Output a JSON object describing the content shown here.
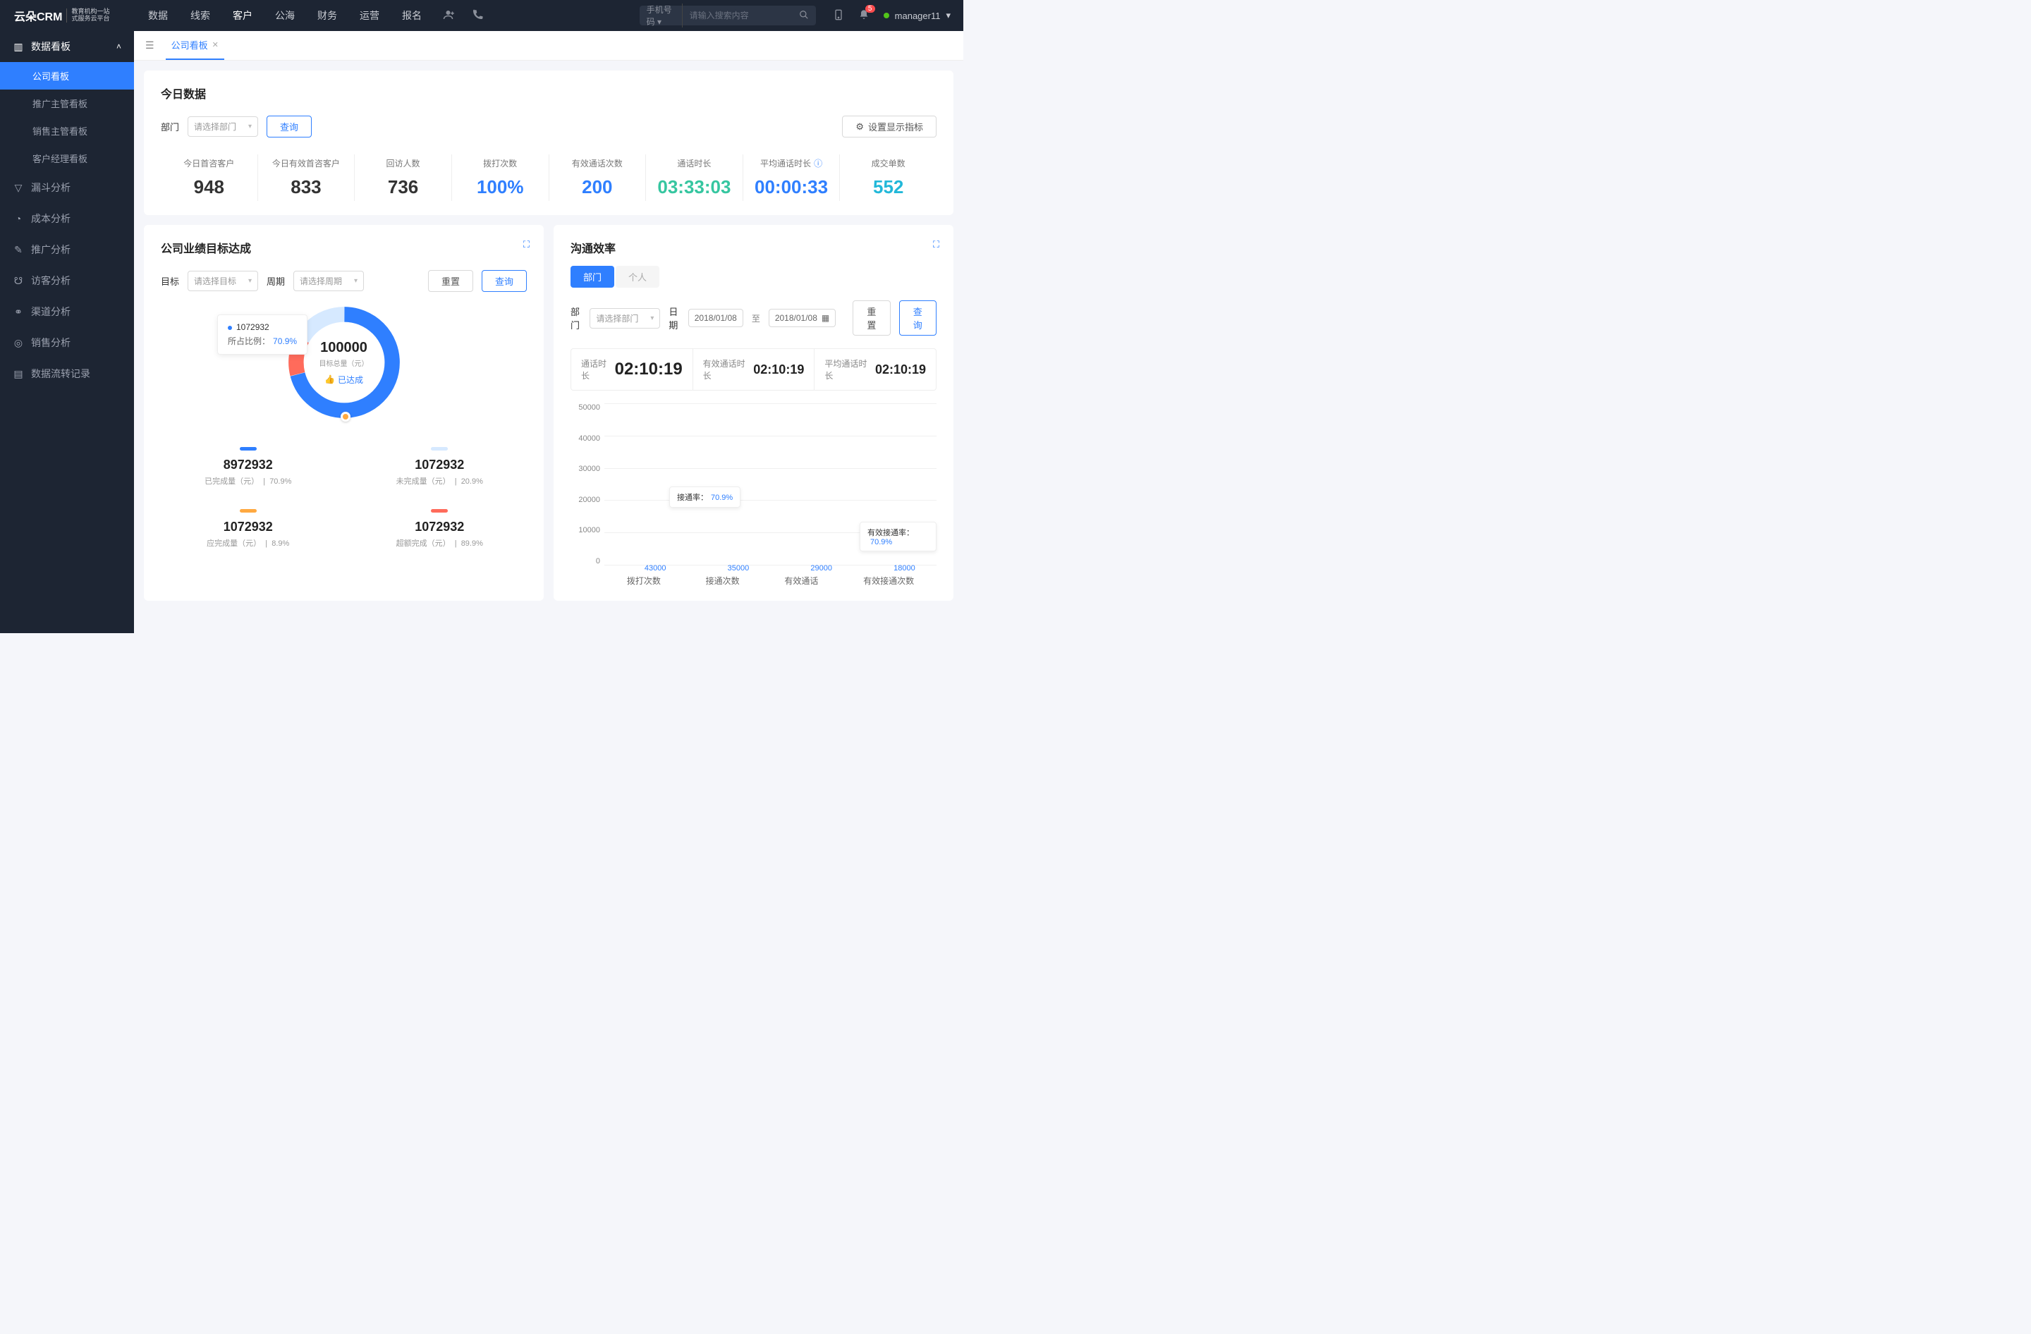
{
  "header": {
    "logo_main": "云朵CRM",
    "logo_sub1": "教育机构一站",
    "logo_sub2": "式服务云平台",
    "nav": [
      "数据",
      "线索",
      "客户",
      "公海",
      "财务",
      "运营",
      "报名"
    ],
    "nav_active_index": 2,
    "search_select": "手机号码",
    "search_placeholder": "请输入搜索内容",
    "notification_count": "5",
    "user_name": "manager11"
  },
  "sidebar": {
    "group": "数据看板",
    "subs": [
      "公司看板",
      "推广主管看板",
      "销售主管看板",
      "客户经理看板"
    ],
    "sub_active_index": 0,
    "items": [
      {
        "icon": "▽",
        "label": "漏斗分析"
      },
      {
        "icon": "◔",
        "label": "成本分析"
      },
      {
        "icon": "✎",
        "label": "推广分析"
      },
      {
        "icon": "☋",
        "label": "访客分析"
      },
      {
        "icon": "⚭",
        "label": "渠道分析"
      },
      {
        "icon": "◎",
        "label": "销售分析"
      },
      {
        "icon": "▤",
        "label": "数据流转记录"
      }
    ]
  },
  "tab": {
    "label": "公司看板"
  },
  "today": {
    "title": "今日数据",
    "filter_label": "部门",
    "filter_placeholder": "请选择部门",
    "query_btn": "查询",
    "settings_btn": "设置显示指标",
    "stats": [
      {
        "label": "今日首咨客户",
        "value": "948",
        "cls": ""
      },
      {
        "label": "今日有效首咨客户",
        "value": "833",
        "cls": ""
      },
      {
        "label": "回访人数",
        "value": "736",
        "cls": ""
      },
      {
        "label": "拨打次数",
        "value": "100%",
        "cls": "c-blue"
      },
      {
        "label": "有效通话次数",
        "value": "200",
        "cls": "c-blue"
      },
      {
        "label": "通话时长",
        "value": "03:33:03",
        "cls": "c-green"
      },
      {
        "label": "平均通话时长",
        "value": "00:00:33",
        "cls": "c-blue",
        "info": true
      },
      {
        "label": "成交单数",
        "value": "552",
        "cls": "c-cyan"
      }
    ]
  },
  "goal": {
    "title": "公司业绩目标达成",
    "target_label": "目标",
    "target_placeholder": "请选择目标",
    "period_label": "周期",
    "period_placeholder": "请选择周期",
    "reset_btn": "重置",
    "query_btn": "查询",
    "tooltip_value": "1072932",
    "tooltip_ratio_label": "所占比例：",
    "tooltip_ratio": "70.9%",
    "center_value": "100000",
    "center_sub": "目标总量（元）",
    "achieved": "已达成",
    "legend": [
      {
        "color": "#2f7fff",
        "num": "8972932",
        "label": "已完成量（元）",
        "pct": "70.9%"
      },
      {
        "color": "#d6e9ff",
        "num": "1072932",
        "label": "未完成量（元）",
        "pct": "20.9%"
      },
      {
        "color": "#ffa940",
        "num": "1072932",
        "label": "应完成量（元）",
        "pct": "8.9%"
      },
      {
        "color": "#ff6b5b",
        "num": "1072932",
        "label": "超额完成（元）",
        "pct": "89.9%"
      }
    ]
  },
  "comm": {
    "title": "沟通效率",
    "seg_dept": "部门",
    "seg_person": "个人",
    "dept_label": "部门",
    "dept_placeholder": "请选择部门",
    "date_label": "日期",
    "date_from": "2018/01/08",
    "date_sep": "至",
    "date_to": "2018/01/08",
    "reset_btn": "重置",
    "query_btn": "查询",
    "info": [
      {
        "label": "通话时长",
        "value": "02:10:19",
        "big": true
      },
      {
        "label": "有效通话时长",
        "value": "02:10:19"
      },
      {
        "label": "平均通话时长",
        "value": "02:10:19"
      }
    ],
    "annot1_label": "接通率：",
    "annot1_pct": "70.9%",
    "annot2_label": "有效接通率：",
    "annot2_pct": "70.9%"
  },
  "chart_data": {
    "type": "bar",
    "ylim": [
      0,
      50000
    ],
    "yticks": [
      0,
      10000,
      20000,
      30000,
      40000,
      50000
    ],
    "categories": [
      "拨打次数",
      "接通次数",
      "有效通话",
      "有效接通次数"
    ],
    "values": [
      43000,
      35000,
      29000,
      18000
    ],
    "value_labels": [
      "43000",
      "35000",
      "29000",
      "18000"
    ],
    "annotations": [
      {
        "label": "接通率：",
        "value": "70.9%"
      },
      {
        "label": "有效接通率：",
        "value": "70.9%"
      }
    ]
  }
}
